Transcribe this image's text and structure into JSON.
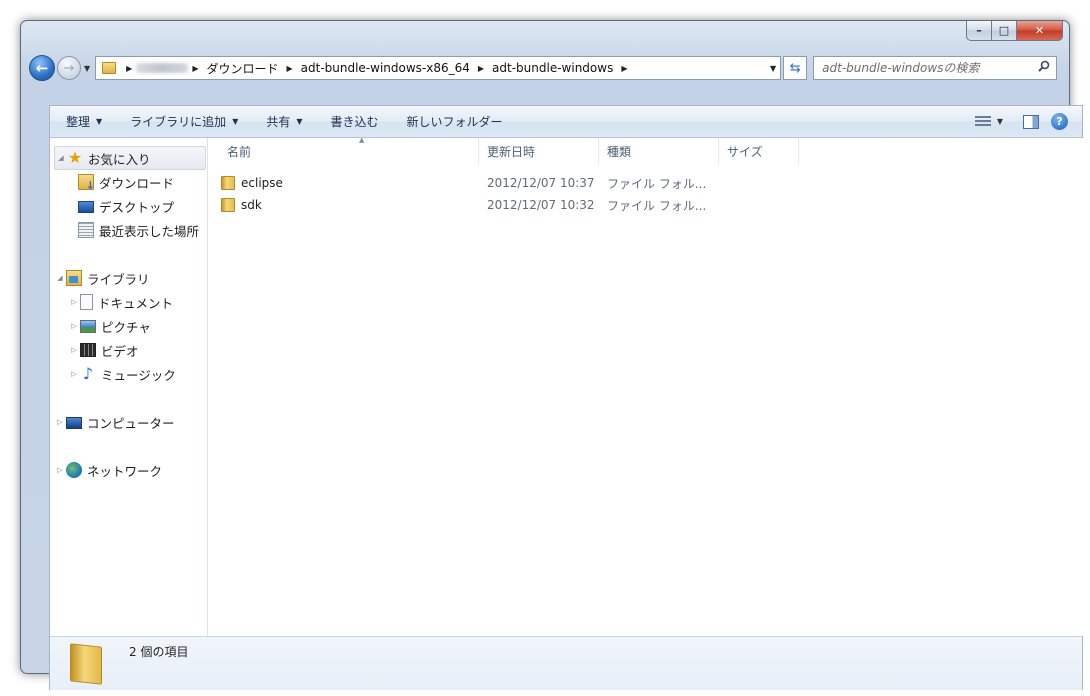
{
  "window": {
    "buttons": {
      "minimize": "–",
      "maximize": "□",
      "close": "✕"
    }
  },
  "nav": {
    "back_glyph": "←",
    "forward_glyph": "→",
    "history_caret": "▼",
    "address_caret": "▼",
    "refresh_glyph": "⇆",
    "breadcrumbs": [
      "ダウンロード",
      "adt-bundle-windows-x86_64",
      "adt-bundle-windows"
    ],
    "search_placeholder": "adt-bundle-windowsの検索"
  },
  "toolbar": {
    "organize": "整理",
    "add_to_library": "ライブラリに追加",
    "share": "共有",
    "burn": "書き込む",
    "new_folder": "新しいフォルダー",
    "help": "?"
  },
  "navpane": {
    "favorites": {
      "label": "お気に入り",
      "items": [
        "ダウンロード",
        "デスクトップ",
        "最近表示した場所"
      ]
    },
    "libraries": {
      "label": "ライブラリ",
      "items": [
        "ドキュメント",
        "ピクチャ",
        "ビデオ",
        "ミュージック"
      ]
    },
    "computer": "コンピューター",
    "network": "ネットワーク"
  },
  "columns": [
    "名前",
    "更新日時",
    "種類",
    "サイズ"
  ],
  "files": [
    {
      "name": "eclipse",
      "modified": "2012/12/07 10:37",
      "type": "ファイル フォル..."
    },
    {
      "name": "sdk",
      "modified": "2012/12/07 10:32",
      "type": "ファイル フォル..."
    }
  ],
  "status": {
    "count": "2 個の項目"
  },
  "colors": {
    "accent": "#2d6fc4",
    "toolbar_text": "#1e3252",
    "close": "#c33a24"
  }
}
